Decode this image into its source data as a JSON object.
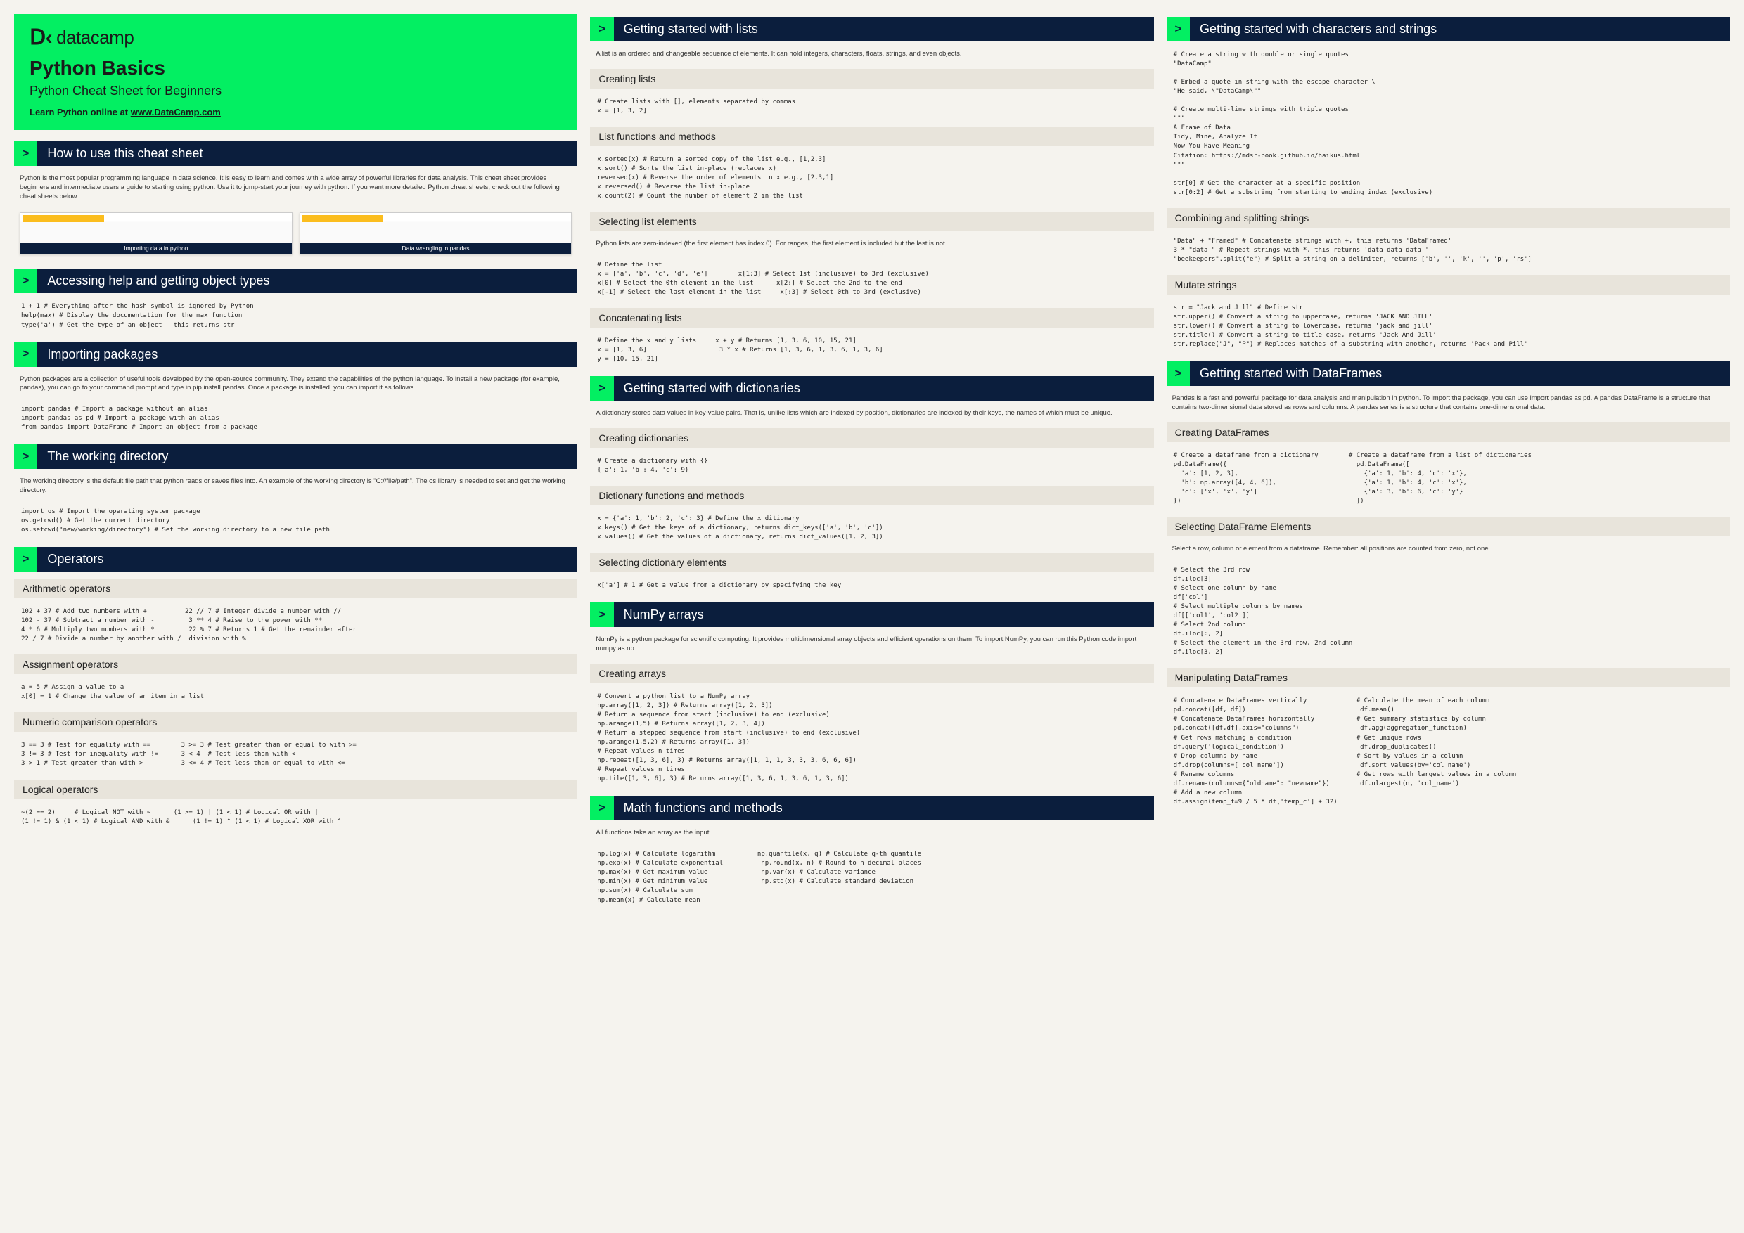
{
  "brand": "datacamp",
  "page_title": "Python Basics",
  "subtitle": "Python Cheat Sheet for Beginners",
  "learn_text": "Learn Python online at ",
  "learn_link": "www.DataCamp.com",
  "chevron": ">",
  "thumbs": {
    "a": "Importing data in python",
    "b": "Data wrangling in pandas"
  },
  "sections": {
    "howto": {
      "title": "How to use this cheat sheet",
      "desc": "Python is the most popular programming language in data science. It is easy to learn and comes with a wide array of powerful libraries for data analysis. This cheat sheet provides beginners and intermediate users a guide to starting using python. Use it to jump-start your journey with python. If you want more detailed Python cheat sheets, check out the following cheat sheets below:"
    },
    "help": {
      "title": "Accessing help and getting object types",
      "code": "1 + 1 # Everything after the hash symbol is ignored by Python\nhelp(max) # Display the documentation for the max function\ntype('a') # Get the type of an object — this returns str"
    },
    "import": {
      "title": "Importing packages",
      "desc": "Python packages are a collection of useful tools developed by the open-source community. They extend the capabilities of the python language. To install a new package (for example, pandas), you can go to your command prompt and type in pip install pandas. Once a package is installed, you can import it as follows.",
      "code": "import pandas # Import a package without an alias\nimport pandas as pd # Import a package with an alias\nfrom pandas import DataFrame # Import an object from a package"
    },
    "wd": {
      "title": "The working directory",
      "desc": "The working directory is the default file path that python reads or saves files into. An example of the working directory is \"C://file/path\". The os library is needed to set and get the working directory.",
      "code": "import os # Import the operating system package\nos.getcwd() # Get the current directory\nos.setcwd(\"new/working/directory\") # Set the working directory to a new file path"
    },
    "ops": {
      "title": "Operators",
      "arith_h": "Arithmetic operators",
      "arith": "102 + 37 # Add two numbers with +          22 // 7 # Integer divide a number with //\n102 - 37 # Subtract a number with -         3 ** 4 # Raise to the power with **\n4 * 6 # Multiply two numbers with *         22 % 7 # Returns 1 # Get the remainder after\n22 / 7 # Divide a number by another with /  division with %",
      "assign_h": "Assignment operators",
      "assign": "a = 5 # Assign a value to a\nx[0] = 1 # Change the value of an item in a list",
      "numcmp_h": "Numeric comparison operators",
      "numcmp": "3 == 3 # Test for equality with ==        3 >= 3 # Test greater than or equal to with >=\n3 != 3 # Test for inequality with !=      3 < 4  # Test less than with <\n3 > 1 # Test greater than with >          3 <= 4 # Test less than or equal to with <=",
      "logic_h": "Logical operators",
      "logic": "~(2 == 2)     # Logical NOT with ~      (1 >= 1) | (1 < 1) # Logical OR with |\n(1 != 1) & (1 < 1) # Logical AND with &      (1 != 1) ^ (1 < 1) # Logical XOR with ^"
    },
    "lists": {
      "title": "Getting started with lists",
      "desc": "A list is an ordered and changeable sequence of elements. It can hold integers, characters, floats, strings, and even objects.",
      "create_h": "Creating lists",
      "create": "# Create lists with [], elements separated by commas\nx = [1, 3, 2]",
      "funcs_h": "List functions and methods",
      "funcs": "x.sorted(x) # Return a sorted copy of the list e.g., [1,2,3]\nx.sort() # Sorts the list in-place (replaces x)\nreversed(x) # Reverse the order of elements in x e.g., [2,3,1]\nx.reversed() # Reverse the list in-place\nx.count(2) # Count the number of element 2 in the list",
      "select_h": "Selecting list elements",
      "select_desc": "Python lists are zero-indexed (the first element has index 0). For ranges, the first element is included but the last is not.",
      "select": "# Define the list\nx = ['a', 'b', 'c', 'd', 'e']        x[1:3] # Select 1st (inclusive) to 3rd (exclusive)\nx[0] # Select the 0th element in the list      x[2:] # Select the 2nd to the end\nx[-1] # Select the last element in the list     x[:3] # Select 0th to 3rd (exclusive)",
      "concat_h": "Concatenating lists",
      "concat": "# Define the x and y lists     x + y # Returns [1, 3, 6, 10, 15, 21]\nx = [1, 3, 6]                   3 * x # Returns [1, 3, 6, 1, 3, 6, 1, 3, 6]\ny = [10, 15, 21]"
    },
    "dicts": {
      "title": "Getting started with dictionaries",
      "desc": "A dictionary stores data values in key-value pairs. That is, unlike lists which are indexed by position, dictionaries are indexed by their keys, the names of which must be unique.",
      "create_h": "Creating dictionaries",
      "create": "# Create a dictionary with {}\n{'a': 1, 'b': 4, 'c': 9}",
      "funcs_h": "Dictionary functions and methods",
      "funcs": "x = {'a': 1, 'b': 2, 'c': 3} # Define the x ditionary\nx.keys() # Get the keys of a dictionary, returns dict_keys(['a', 'b', 'c'])\nx.values() # Get the values of a dictionary, returns dict_values([1, 2, 3])",
      "select_h": "Selecting dictionary elements",
      "select": "x['a'] # 1 # Get a value from a dictionary by specifying the key"
    },
    "numpy": {
      "title": "NumPy arrays",
      "desc": "NumPy is a python package for scientific computing. It provides multidimensional array objects and efficient operations on them. To import NumPy, you can run this Python code import numpy as np",
      "create_h": "Creating arrays",
      "create": "# Convert a python list to a NumPy array\nnp.array([1, 2, 3]) # Returns array([1, 2, 3])\n# Return a sequence from start (inclusive) to end (exclusive)\nnp.arange(1,5) # Returns array([1, 2, 3, 4])\n# Return a stepped sequence from start (inclusive) to end (exclusive)\nnp.arange(1,5,2) # Returns array([1, 3])\n# Repeat values n times\nnp.repeat([1, 3, 6], 3) # Returns array([1, 1, 1, 3, 3, 3, 6, 6, 6])\n# Repeat values n times\nnp.tile([1, 3, 6], 3) # Returns array([1, 3, 6, 1, 3, 6, 1, 3, 6])"
    },
    "math": {
      "title": "Math functions and methods",
      "desc": "All functions take an array as the input.",
      "code": "np.log(x) # Calculate logarithm           np.quantile(x, q) # Calculate q-th quantile\nnp.exp(x) # Calculate exponential          np.round(x, n) # Round to n decimal places\nnp.max(x) # Get maximum value              np.var(x) # Calculate variance\nnp.min(x) # Get minimum value              np.std(x) # Calculate standard deviation\nnp.sum(x) # Calculate sum\nnp.mean(x) # Calculate mean"
    },
    "strings": {
      "title": "Getting started with characters and strings",
      "code1": "# Create a string with double or single quotes\n\"DataCamp\"\n\n# Embed a quote in string with the escape character \\\n\"He said, \\\"DataCamp\\\"\"\n\n# Create multi-line strings with triple quotes\n\"\"\"\nA Frame of Data\nTidy, Mine, Analyze It\nNow You Have Meaning\nCitation: https://mdsr-book.github.io/haikus.html\n\"\"\"\n\nstr[0] # Get the character at a specific position\nstr[0:2] # Get a substring from starting to ending index (exclusive)",
      "combine_h": "Combining and splitting strings",
      "combine": "\"Data\" + \"Framed\" # Concatenate strings with +, this returns 'DataFramed'\n3 * \"data \" # Repeat strings with *, this returns 'data data data '\n\"beekeepers\".split(\"e\") # Split a string on a delimiter, returns ['b', '', 'k', '', 'p', 'rs']",
      "mutate_h": "Mutate strings",
      "mutate": "str = \"Jack and Jill\" # Define str\nstr.upper() # Convert a string to uppercase, returns 'JACK AND JILL'\nstr.lower() # Convert a string to lowercase, returns 'jack and jill'\nstr.title() # Convert a string to title case, returns 'Jack And Jill'\nstr.replace(\"J\", \"P\") # Replaces matches of a substring with another, returns 'Pack and Pill'"
    },
    "df": {
      "title": "Getting started with DataFrames",
      "desc": "Pandas is a fast and powerful package for data analysis and manipulation in python. To import the package, you can use import pandas as pd. A pandas DataFrame is a structure that contains two-dimensional data stored as rows and columns. A pandas series is a structure that contains one-dimensional data.",
      "create_h": "Creating DataFrames",
      "create": "# Create a dataframe from a dictionary        # Create a dataframe from a list of dictionaries\npd.DataFrame({                                  pd.DataFrame([\n  'a': [1, 2, 3],                                 {'a': 1, 'b': 4, 'c': 'x'},\n  'b': np.array([4, 4, 6]),                       {'a': 1, 'b': 4, 'c': 'x'},\n  'c': ['x', 'x', 'y']                            {'a': 3, 'b': 6, 'c': 'y'}\n})                                              ])",
      "select_h": "Selecting DataFrame Elements",
      "select_desc": "Select a row, column or element from a dataframe. Remember: all positions are counted from zero, not one.",
      "select": "# Select the 3rd row\ndf.iloc[3]\n# Select one column by name\ndf['col']\n# Select multiple columns by names\ndf[['col1', 'col2']]\n# Select 2nd column\ndf.iloc[:, 2]\n# Select the element in the 3rd row, 2nd column\ndf.iloc[3, 2]",
      "manip_h": "Manipulating DataFrames",
      "manip": "# Concatenate DataFrames vertically             # Calculate the mean of each column\npd.concat([df, df])                              df.mean()\n# Concatenate DataFrames horizontally           # Get summary statistics by column\npd.concat([df,df],axis=\"columns\")                df.agg(aggregation_function)\n# Get rows matching a condition                 # Get unique rows\ndf.query('logical_condition')                    df.drop_duplicates()\n# Drop columns by name                          # Sort by values in a column\ndf.drop(columns=['col_name'])                    df.sort_values(by='col_name')\n# Rename columns                                # Get rows with largest values in a column\ndf.rename(columns={\"oldname\": \"newname\"})        df.nlargest(n, 'col_name')\n# Add a new column\ndf.assign(temp_f=9 / 5 * df['temp_c'] + 32)"
    }
  }
}
